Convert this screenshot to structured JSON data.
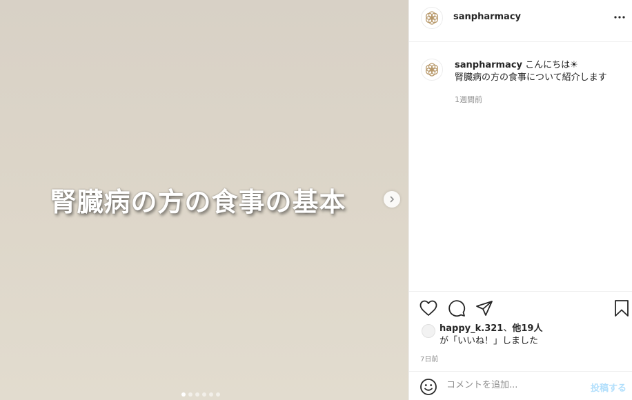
{
  "post": {
    "media_title": "腎臓病の方の食事の基本",
    "carousel_count": 6,
    "carousel_active": 0
  },
  "header": {
    "username": "sanpharmacy",
    "more_icon": "more-horizontal-icon"
  },
  "caption": {
    "username": "sanpharmacy",
    "greeting": "こんにちは",
    "greeting_emoji": "☀",
    "line2": "腎臓病の方の食事について紹介します",
    "time": "1週間前"
  },
  "actions": {
    "icons": [
      "heart-icon",
      "comment-icon",
      "share-icon",
      "bookmark-icon"
    ]
  },
  "likes": {
    "user": "happy_k.321",
    "separator": "、",
    "others": "他19人",
    "suffix": "が「いいね！」しました"
  },
  "post_time": "7日前",
  "comment": {
    "placeholder": "コメントを追加...",
    "post_label": "投稿する"
  },
  "colors": {
    "accent_disabled": "#b2dffc",
    "muted": "#8e8e8e",
    "logo": "#b8996b"
  }
}
